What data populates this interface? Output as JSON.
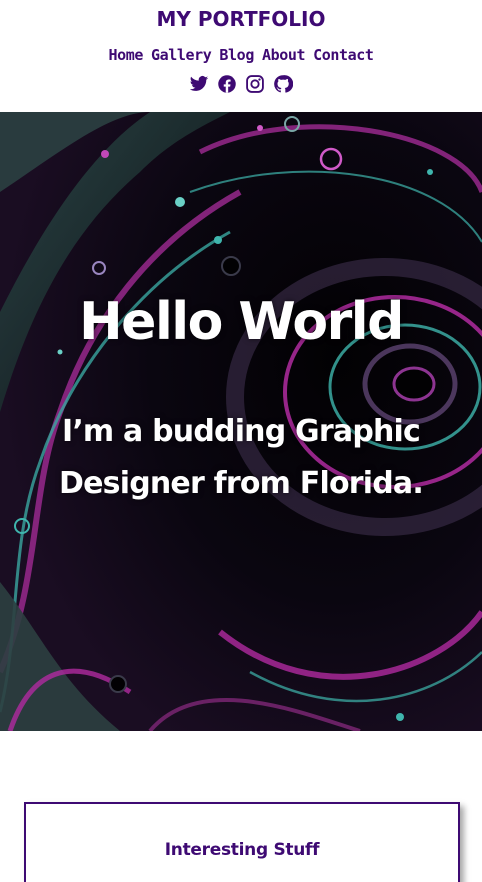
{
  "header": {
    "site_title": "MY PORTFOLIO",
    "nav": [
      "Home",
      "Gallery",
      "Blog",
      "About",
      "Contact"
    ],
    "social_icons": [
      "twitter-icon",
      "facebook-icon",
      "instagram-icon",
      "github-icon"
    ]
  },
  "hero": {
    "title": "Hello World",
    "subtitle": "I’m a budding Graphic Designer from Florida."
  },
  "section": {
    "card_title": "Interesting Stuff"
  },
  "colors": {
    "accent": "#3e0a73",
    "hero_bg": "#050208",
    "hero_magenta": "#b02ba0",
    "hero_teal": "#3fb5ad"
  }
}
